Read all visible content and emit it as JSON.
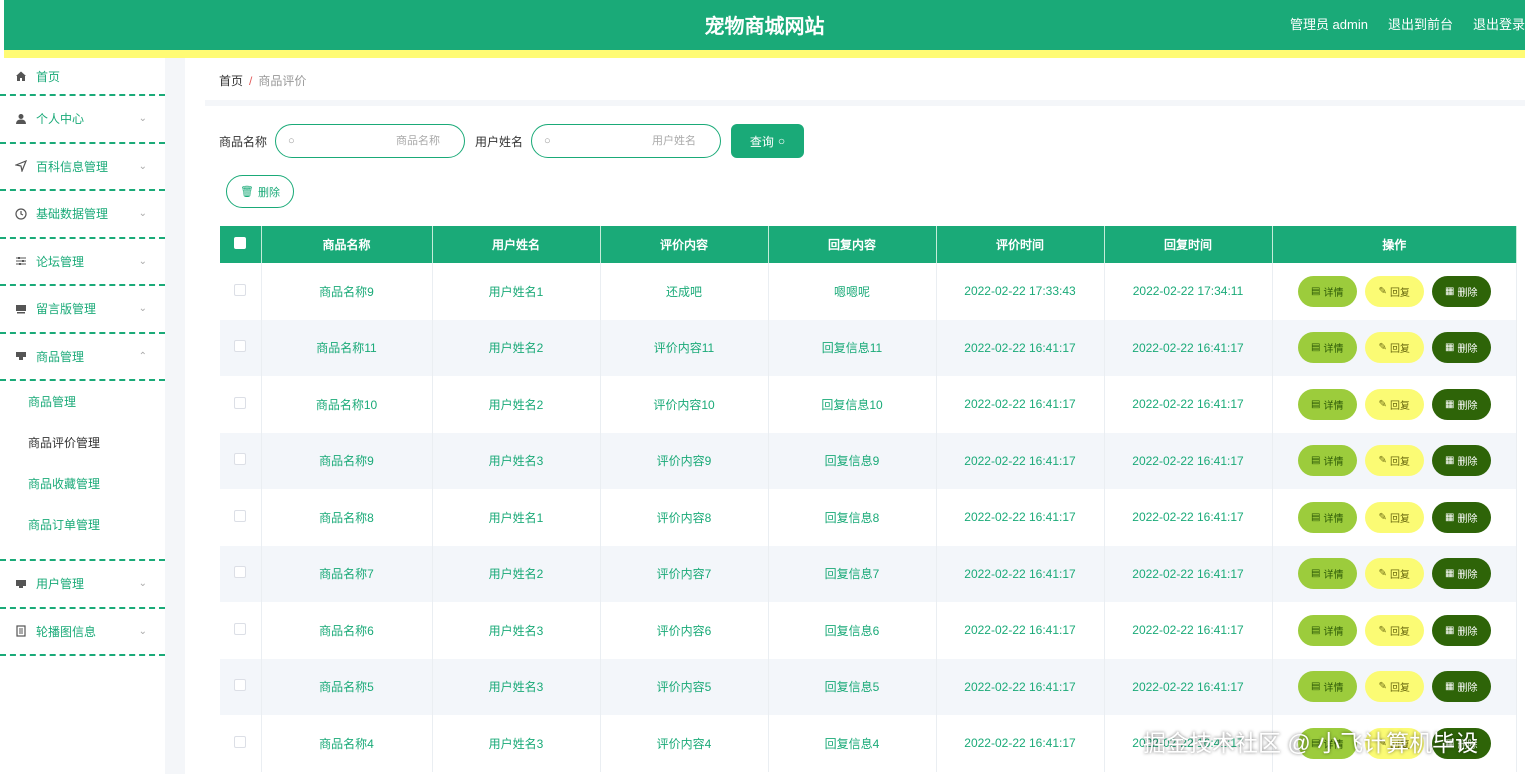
{
  "header": {
    "title": "宠物商城网站",
    "admin_label": "管理员 admin",
    "front_label": "退出到前台",
    "logout_label": "退出登录"
  },
  "sidebar": {
    "home": "首页",
    "items": [
      {
        "label": "个人中心",
        "icon": "user-icon",
        "expanded": false
      },
      {
        "label": "百科信息管理",
        "icon": "send-icon",
        "expanded": false
      },
      {
        "label": "基础数据管理",
        "icon": "clock-icon",
        "expanded": false
      },
      {
        "label": "论坛管理",
        "icon": "sliders-icon",
        "expanded": false
      },
      {
        "label": "留言版管理",
        "icon": "message-icon",
        "expanded": false
      },
      {
        "label": "商品管理",
        "icon": "goods-icon",
        "expanded": true
      }
    ],
    "submenu": [
      "商品管理",
      "商品评价管理",
      "商品收藏管理",
      "商品订单管理"
    ],
    "items_after": [
      {
        "label": "用户管理",
        "icon": "user-card-icon",
        "expanded": false
      },
      {
        "label": "轮播图信息",
        "icon": "image-icon",
        "expanded": false
      }
    ]
  },
  "breadcrumb": {
    "home": "首页",
    "sep": "/",
    "current": "商品评价"
  },
  "search": {
    "goods_label": "商品名称",
    "goods_placeholder": "商品名称",
    "user_label": "用户姓名",
    "user_placeholder": "用户姓名",
    "query_label": "查询"
  },
  "batch_delete_label": "删除",
  "table": {
    "columns": [
      "商品名称",
      "用户姓名",
      "评价内容",
      "回复内容",
      "评价时间",
      "回复时间",
      "操作"
    ],
    "rows": [
      [
        "商品名称9",
        "用户姓名1",
        "还成吧",
        "嗯嗯呢",
        "2022-02-22 17:33:43",
        "2022-02-22 17:34:11"
      ],
      [
        "商品名称11",
        "用户姓名2",
        "评价内容11",
        "回复信息11",
        "2022-02-22 16:41:17",
        "2022-02-22 16:41:17"
      ],
      [
        "商品名称10",
        "用户姓名2",
        "评价内容10",
        "回复信息10",
        "2022-02-22 16:41:17",
        "2022-02-22 16:41:17"
      ],
      [
        "商品名称9",
        "用户姓名3",
        "评价内容9",
        "回复信息9",
        "2022-02-22 16:41:17",
        "2022-02-22 16:41:17"
      ],
      [
        "商品名称8",
        "用户姓名1",
        "评价内容8",
        "回复信息8",
        "2022-02-22 16:41:17",
        "2022-02-22 16:41:17"
      ],
      [
        "商品名称7",
        "用户姓名2",
        "评价内容7",
        "回复信息7",
        "2022-02-22 16:41:17",
        "2022-02-22 16:41:17"
      ],
      [
        "商品名称6",
        "用户姓名3",
        "评价内容6",
        "回复信息6",
        "2022-02-22 16:41:17",
        "2022-02-22 16:41:17"
      ],
      [
        "商品名称5",
        "用户姓名3",
        "评价内容5",
        "回复信息5",
        "2022-02-22 16:41:17",
        "2022-02-22 16:41:17"
      ],
      [
        "商品名称4",
        "用户姓名3",
        "评价内容4",
        "回复信息4",
        "2022-02-22 16:41:17",
        "2022-02-22 16:41:17"
      ]
    ],
    "actions": {
      "detail": "详情",
      "reply": "回复",
      "delete": "删除"
    }
  },
  "watermark": "掘金技术社区 @ 小飞计算机毕设",
  "colors": {
    "primary": "#1aaa78",
    "accent_yellow": "#fffb74",
    "detail_btn": "#9ccc3c",
    "reply_btn": "#fbfb74",
    "delete_btn": "#2e6408"
  }
}
